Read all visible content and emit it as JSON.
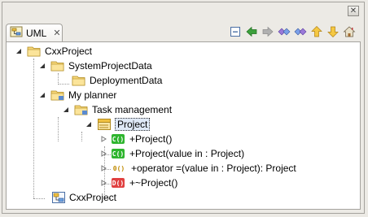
{
  "view": {
    "tab_label": "UML",
    "tab_close": "✕",
    "window_close": "✕"
  },
  "toolbar": {
    "buttons": [
      {
        "icon": "collapse-all-icon"
      },
      {
        "icon": "back-arrow-icon"
      },
      {
        "icon": "forward-arrow-icon"
      },
      {
        "icon": "double-diamond-left-icon"
      },
      {
        "icon": "double-diamond-right-icon"
      },
      {
        "icon": "up-arrow-icon"
      },
      {
        "icon": "down-arrow-icon"
      },
      {
        "icon": "home-icon"
      }
    ]
  },
  "tree": {
    "root": "CxxProject",
    "system_project_data": "SystemProjectData",
    "deployment_data": "DeploymentData",
    "my_planner": "My planner",
    "task_management": "Task management",
    "project": "Project",
    "methods": [
      {
        "badge": "C()",
        "text": "+Project()"
      },
      {
        "badge": "C()",
        "text": "+Project(value in : Project)"
      },
      {
        "badge": "0()",
        "text": "+operator =(value in : Project): Project"
      },
      {
        "badge": "D()",
        "text": "+~Project()"
      }
    ],
    "diagram": "CxxProject"
  }
}
